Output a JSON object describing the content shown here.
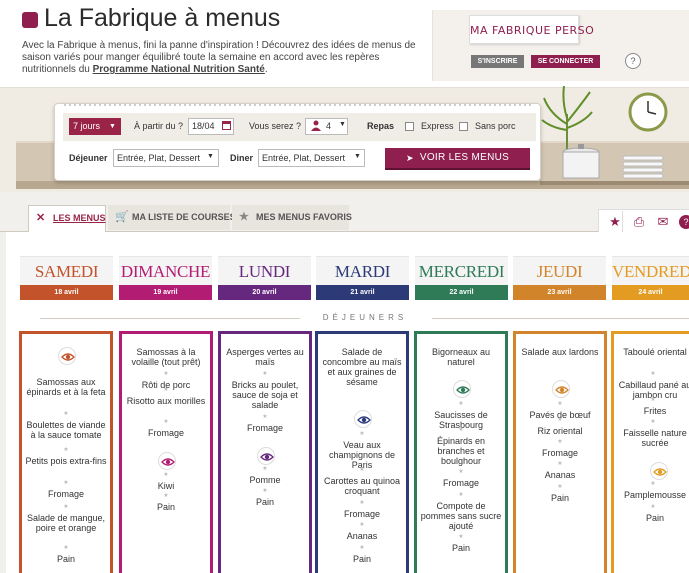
{
  "header": {
    "title": "La Fabrique à menus",
    "intro_text": "Avec la Fabrique à menus, fini la panne d'inspiration ! Découvrez des idées de menus de saison variés pour manger équilibré toute la semaine en accord avec les repères nutritionnels du",
    "intro_link": "Programme National Nutrition Santé",
    "intro_end": "."
  },
  "account": {
    "logo_text": "MA FABRIQUE PERSO",
    "signup_label": "S'INSCRIRE",
    "login_label": "SE CONNECTER",
    "help_label": "?"
  },
  "form": {
    "days_value": "7 jours",
    "from_label": "À partir du ?",
    "date_value": "18/04",
    "persons_label": "Vous serez ?",
    "persons_value": "4",
    "meals_label": "Repas",
    "express_label": "Express",
    "no_pork_label": "Sans porc",
    "lunch_label": "Déjeuner",
    "lunch_value": "Entrée, Plat, Dessert",
    "dinner_label": "Diner",
    "dinner_value": "Entrée, Plat, Dessert",
    "submit_label": "VOIR LES MENUS"
  },
  "tabs": [
    {
      "label": "LES MENUS",
      "icon": "cutlery-icon",
      "active": true
    },
    {
      "label": "MA LISTE DE COURSES",
      "icon": "cart-icon",
      "active": false
    },
    {
      "label": "MES MENUS FAVORIS",
      "icon": "star-icon",
      "active": false
    }
  ],
  "tools": [
    "star-icon",
    "print-icon",
    "mail-icon",
    "help-icon"
  ],
  "section_label": "DÉJEUNERS",
  "days": [
    {
      "name": "SAMEDI",
      "date": "18 avril",
      "color": "#c2532b",
      "items": [
        "Samossas aux épinards et à la feta",
        "Boulettes de viande à la sauce tomate",
        "Petits pois extra-fins",
        "Fromage",
        "Salade de mangue, poire et orange",
        "Pain"
      ]
    },
    {
      "name": "DIMANCHE",
      "date": "19 avril",
      "color": "#b21d73",
      "items": [
        "Samossas à la volaille (tout prêt)",
        "Rôti de porc",
        "Risotto aux morilles",
        "Fromage",
        "Kiwi",
        "Pain"
      ]
    },
    {
      "name": "LUNDI",
      "date": "20 avril",
      "color": "#66287f",
      "items": [
        "Asperges vertes au maïs",
        "Bricks au poulet, sauce de soja et salade",
        "Fromage",
        "Pomme",
        "Pain"
      ]
    },
    {
      "name": "MARDI",
      "date": "21 avril",
      "color": "#2c3a78",
      "items": [
        "Salade de concombre au maïs et aux graines de sésame",
        "Veau aux champignons de Paris",
        "Carottes au quinoa croquant",
        "Fromage",
        "Ananas",
        "Pain"
      ]
    },
    {
      "name": "MERCREDI",
      "date": "22 avril",
      "color": "#2f7a57",
      "items": [
        "Bigorneaux au naturel",
        "Saucisses de Strasbourg",
        "Épinards en branches et boulghour",
        "Fromage",
        "Compote de pommes sans sucre ajouté",
        "Pain"
      ]
    },
    {
      "name": "JEUDI",
      "date": "23 avril",
      "color": "#d2842a",
      "items": [
        "Salade aux lardons",
        "Pavés de bœuf",
        "Riz oriental",
        "Fromage",
        "Ananas",
        "Pain"
      ]
    },
    {
      "name": "VENDREDI",
      "date": "24 avril",
      "color": "#e39b22",
      "items": [
        "Taboulé oriental",
        "Cabillaud pané au jambon cru",
        "Frites",
        "Faisselle nature sucrée",
        "Pamplemousse",
        "Pain"
      ]
    }
  ]
}
